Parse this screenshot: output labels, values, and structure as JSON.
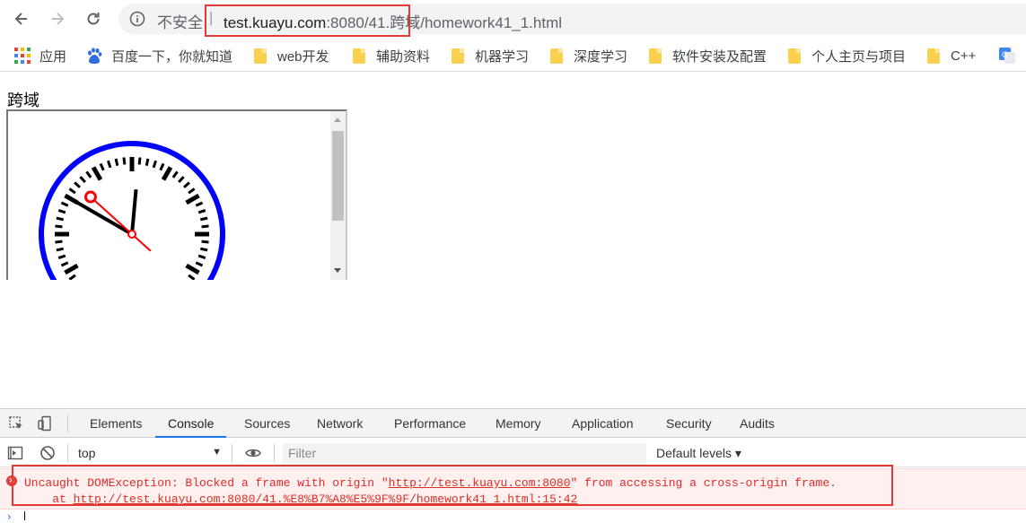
{
  "browser": {
    "security_label": "不安全",
    "separator": "|",
    "url_host": "test.kuayu.com",
    "url_rest": ":8080/41.跨域/homework41_1.html"
  },
  "bookmarks": [
    {
      "label": "应用",
      "icon": "apps-grid-icon"
    },
    {
      "label": "百度一下，你就知道",
      "icon": "baidu-paw-icon"
    },
    {
      "label": "web开发",
      "icon": "folder-icon"
    },
    {
      "label": "辅助资料",
      "icon": "folder-icon"
    },
    {
      "label": "机器学习",
      "icon": "folder-icon"
    },
    {
      "label": "深度学习",
      "icon": "folder-icon"
    },
    {
      "label": "软件安装及配置",
      "icon": "folder-icon"
    },
    {
      "label": "个人主页与项目",
      "icon": "folder-icon"
    },
    {
      "label": "C++",
      "icon": "folder-icon"
    }
  ],
  "page": {
    "heading": "跨域",
    "clock": {
      "hour": 10,
      "minute": 0,
      "second": 52,
      "rim_color": "#0000ff",
      "second_hand_color": "#ff0000"
    }
  },
  "devtools": {
    "tabs": [
      "Elements",
      "Console",
      "Sources",
      "Network",
      "Performance",
      "Memory",
      "Application",
      "Security",
      "Audits"
    ],
    "active_tab": "Console",
    "context": "top",
    "filter_placeholder": "Filter",
    "levels": "Default levels ▾",
    "error": {
      "prefix": "Uncaught DOMException: Blocked a frame with origin \"",
      "origin_link": "http://test.kuayu.com:8080",
      "suffix": "\" from accessing a cross-origin frame.",
      "at": "    at ",
      "source_link": "http://test.kuayu.com:8080/41.%E8%B7%A8%E5%9F%9F/homework41_1.html:15:42"
    },
    "prompt": "›"
  },
  "colors": {
    "highlight_box": "#e53935",
    "error_text": "#e32a2a",
    "error_bg": "#fff0f0",
    "accent": "#1a73e8"
  }
}
